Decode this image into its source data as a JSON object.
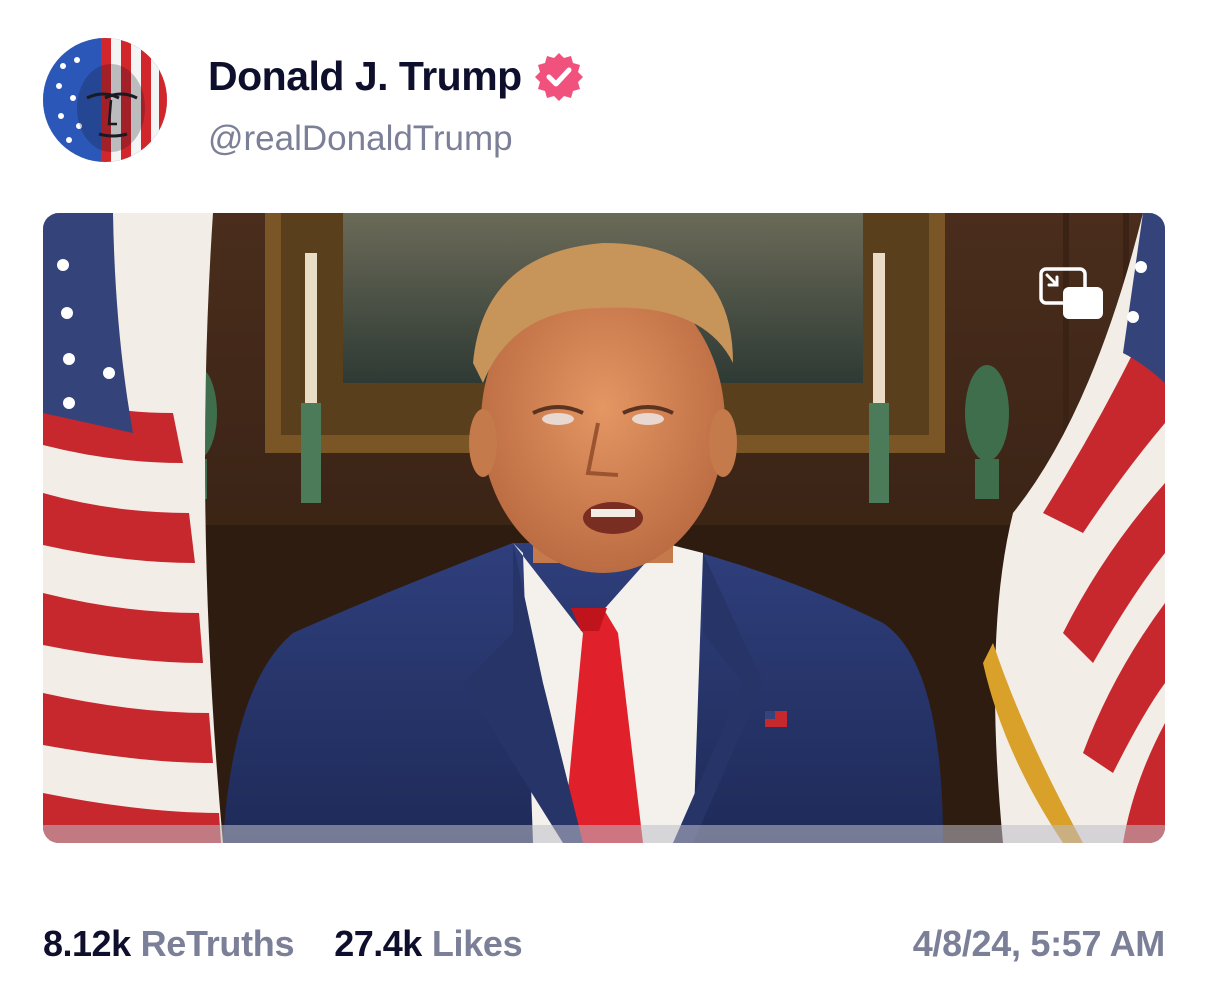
{
  "post": {
    "author": {
      "display_name": "Donald J. Trump",
      "handle": "@realDonaldTrump",
      "verified": true,
      "avatar_icon": "flag-face-avatar",
      "verified_color": "#f0517d"
    },
    "media": {
      "type": "video",
      "pip_icon": "picture-in-picture-icon"
    },
    "stats": {
      "retruths_count": "8.12k",
      "retruths_label": "ReTruths",
      "likes_count": "27.4k",
      "likes_label": "Likes"
    },
    "timestamp": "4/8/24, 5:57 AM"
  },
  "colors": {
    "text_primary": "#0e0f2c",
    "text_secondary": "#7b7f97",
    "badge": "#f0517d"
  }
}
